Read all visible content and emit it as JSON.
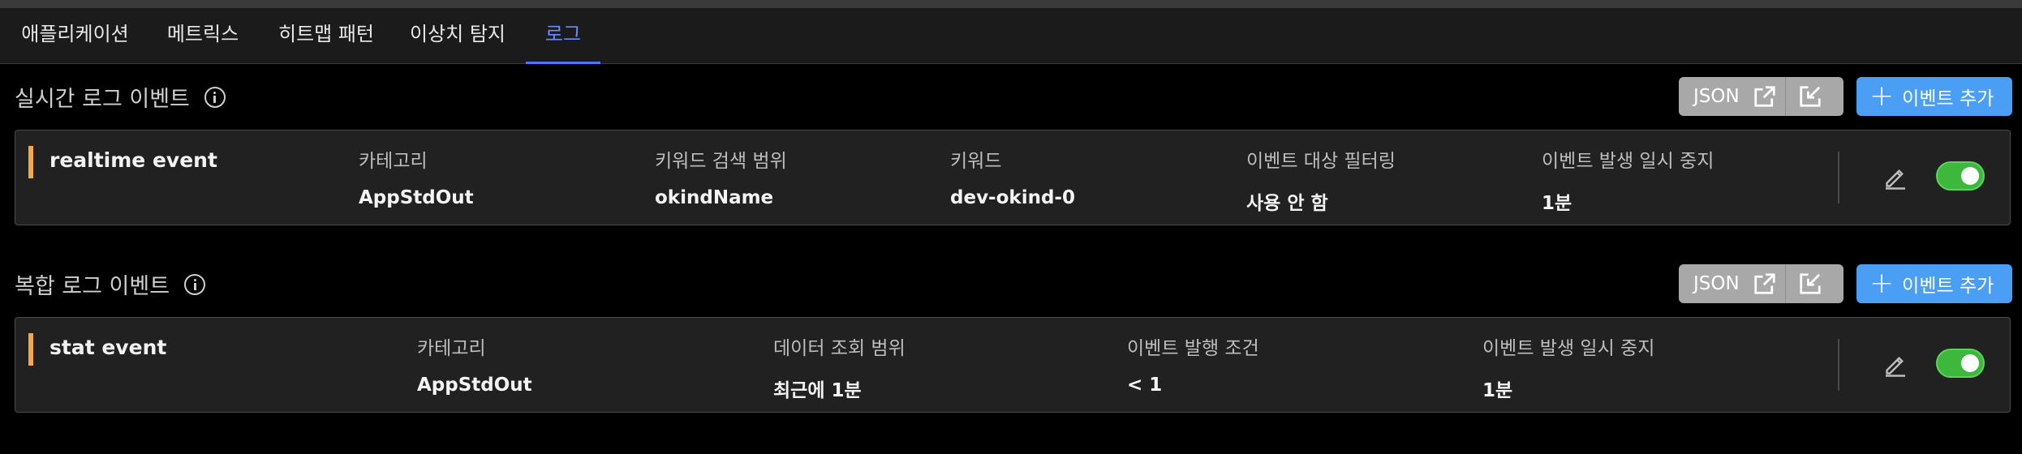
{
  "tabs": [
    {
      "label": "애플리케이션"
    },
    {
      "label": "메트릭스"
    },
    {
      "label": "히트맵 패턴"
    },
    {
      "label": "이상치 탐지"
    },
    {
      "label": "로그",
      "active": true
    }
  ],
  "toolbar": {
    "json_label": "JSON",
    "add_label": "이벤트 추가",
    "icons": [
      "external-link-icon",
      "import-icon",
      "plus-icon"
    ]
  },
  "realtime": {
    "title": "실시간 로그 이벤트",
    "event": {
      "name": "realtime event",
      "columns": [
        {
          "header": "카테고리",
          "value": "AppStdOut"
        },
        {
          "header": "키워드 검색 범위",
          "value": "okindName"
        },
        {
          "header": "키워드",
          "value": "dev-okind-0"
        },
        {
          "header": "이벤트 대상 필터링",
          "value": "사용 안 함"
        },
        {
          "header": "이벤트 발생 일시 중지",
          "value": "1분"
        }
      ],
      "enabled": true
    }
  },
  "composite": {
    "title": "복합 로그 이벤트",
    "event": {
      "name": "stat event",
      "columns": [
        {
          "header": "카테고리",
          "value": "AppStdOut"
        },
        {
          "header": "데이터 조회 범위",
          "value": "최근에 1분"
        },
        {
          "header": "이벤트 발행 조건",
          "value": "< 1"
        },
        {
          "header": "이벤트 발생 일시 중지",
          "value": "1분"
        }
      ],
      "enabled": true
    }
  },
  "colors": {
    "accent": "#f5a742",
    "primary": "#4a9ff5",
    "active_tab": "#6b8cff",
    "toggle_on": "#3db83d"
  }
}
